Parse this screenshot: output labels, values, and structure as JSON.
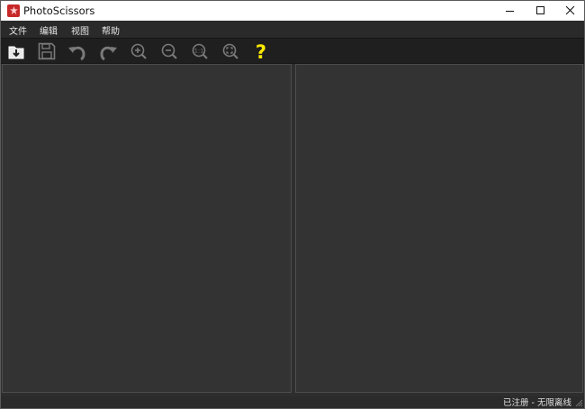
{
  "window": {
    "title": "PhotoScissors",
    "controls": [
      "minimize",
      "maximize",
      "close"
    ]
  },
  "menu": {
    "items": [
      {
        "label": "文件"
      },
      {
        "label": "编辑"
      },
      {
        "label": "视图"
      },
      {
        "label": "帮助"
      }
    ]
  },
  "toolbar": {
    "tools": [
      {
        "icon": "open-image-icon"
      },
      {
        "icon": "save-icon"
      },
      {
        "icon": "undo-icon"
      },
      {
        "icon": "redo-icon"
      },
      {
        "icon": "zoom-in-icon"
      },
      {
        "icon": "zoom-out-icon"
      },
      {
        "icon": "zoom-actual-size-icon",
        "label": "1:1"
      },
      {
        "icon": "zoom-fit-icon"
      },
      {
        "icon": "help-icon",
        "label": "?"
      }
    ],
    "colors": {
      "help": "#ffea00",
      "icon_dim": "#7a7a7a",
      "icon_light": "#e6e6e6"
    }
  },
  "status": {
    "text": "已注册 - 无限离线"
  }
}
